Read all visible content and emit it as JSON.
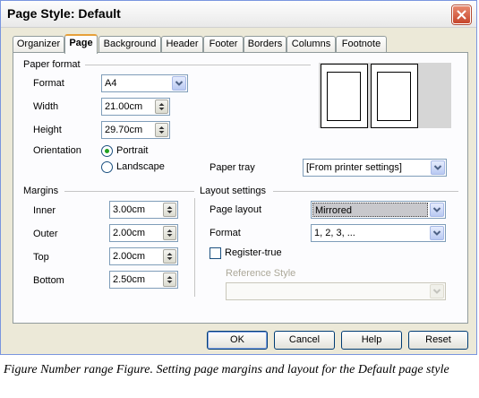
{
  "dialog": {
    "title": "Page Style: Default",
    "close_icon": "close-x-icon"
  },
  "tabs": [
    "Organizer",
    "Page",
    "Background",
    "Header",
    "Footer",
    "Borders",
    "Columns",
    "Footnote"
  ],
  "active_tab": "Page",
  "paper_format": {
    "section_label": "Paper format",
    "format_label": "Format",
    "format_value": "A4",
    "width_label": "Width",
    "width_value": "21.00cm",
    "height_label": "Height",
    "height_value": "29.70cm",
    "orientation_label": "Orientation",
    "portrait_label": "Portrait",
    "landscape_label": "Landscape",
    "orientation_selected": "Portrait",
    "paper_tray_label": "Paper tray",
    "paper_tray_value": "[From printer settings]"
  },
  "margins": {
    "section_label": "Margins",
    "inner_label": "Inner",
    "inner_value": "3.00cm",
    "outer_label": "Outer",
    "outer_value": "2.00cm",
    "top_label": "Top",
    "top_value": "2.00cm",
    "bottom_label": "Bottom",
    "bottom_value": "2.50cm"
  },
  "layout_settings": {
    "section_label": "Layout settings",
    "page_layout_label": "Page layout",
    "page_layout_value": "Mirrored",
    "format_label": "Format",
    "format_value": "1, 2, 3, ...",
    "register_true_label": "Register-true",
    "register_true_checked": false,
    "reference_style_label": "Reference Style",
    "reference_style_value": ""
  },
  "buttons": {
    "ok": "OK",
    "cancel": "Cancel",
    "help": "Help",
    "reset": "Reset"
  },
  "caption": "Figure Number range Figure. Setting page margins and layout for the Default page style"
}
